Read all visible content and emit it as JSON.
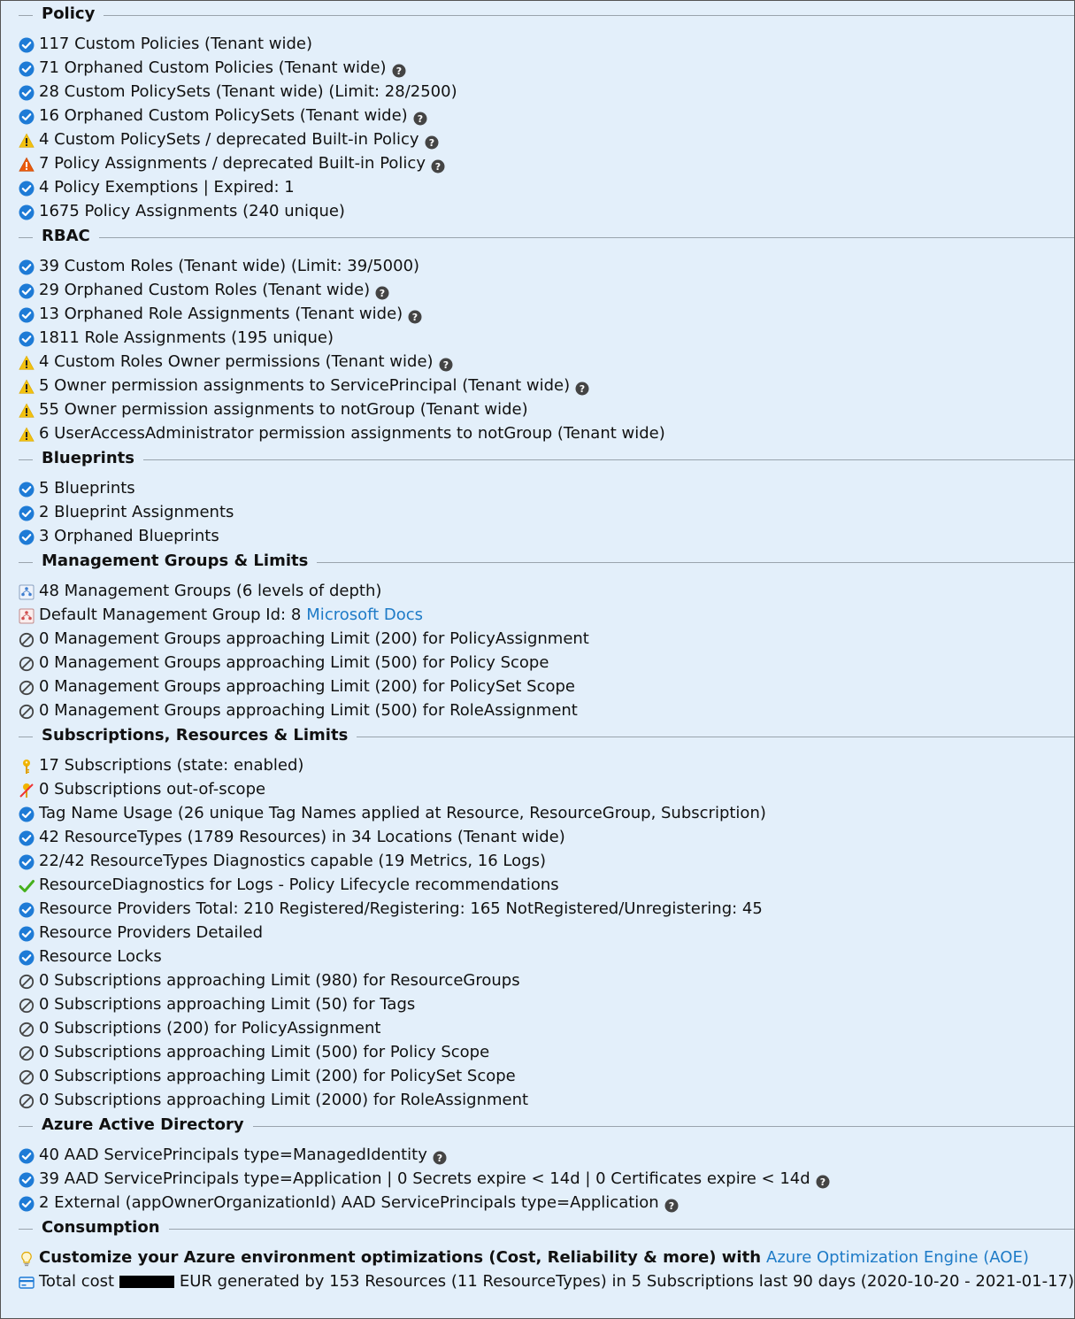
{
  "sections": [
    {
      "title": "Policy",
      "rows": [
        {
          "icon": "check-circle",
          "text": "117 Custom Policies (Tenant wide)",
          "help": false
        },
        {
          "icon": "check-circle",
          "text": "71 Orphaned Custom Policies (Tenant wide)",
          "help": true
        },
        {
          "icon": "check-circle",
          "text": "28 Custom PolicySets (Tenant wide) (Limit: 28/2500)",
          "help": false
        },
        {
          "icon": "check-circle",
          "text": "16 Orphaned Custom PolicySets (Tenant wide)",
          "help": true
        },
        {
          "icon": "warning-yellow",
          "text": "4 Custom PolicySets / deprecated Built-in Policy",
          "help": true
        },
        {
          "icon": "warning-orange",
          "text": "7 Policy Assignments / deprecated Built-in Policy",
          "help": true
        },
        {
          "icon": "check-circle",
          "text": "4 Policy Exemptions | Expired: 1",
          "help": false
        },
        {
          "icon": "check-circle",
          "text": "1675 Policy Assignments (240 unique)",
          "help": false
        }
      ]
    },
    {
      "title": "RBAC",
      "rows": [
        {
          "icon": "check-circle",
          "text": "39 Custom Roles (Tenant wide) (Limit: 39/5000)",
          "help": false
        },
        {
          "icon": "check-circle",
          "text": "29 Orphaned Custom Roles (Tenant wide)",
          "help": true
        },
        {
          "icon": "check-circle",
          "text": "13 Orphaned Role Assignments (Tenant wide)",
          "help": true
        },
        {
          "icon": "check-circle",
          "text": "1811 Role Assignments (195 unique)",
          "help": false
        },
        {
          "icon": "warning-yellow",
          "text": "4 Custom Roles Owner permissions (Tenant wide)",
          "help": true
        },
        {
          "icon": "warning-yellow",
          "text": "5 Owner permission assignments to ServicePrincipal (Tenant wide)",
          "help": true
        },
        {
          "icon": "warning-yellow",
          "text": "55 Owner permission assignments to notGroup (Tenant wide)",
          "help": false
        },
        {
          "icon": "warning-yellow",
          "text": "6 UserAccessAdministrator permission assignments to notGroup (Tenant wide)",
          "help": false
        }
      ]
    },
    {
      "title": "Blueprints",
      "rows": [
        {
          "icon": "check-circle",
          "text": "5 Blueprints",
          "help": false
        },
        {
          "icon": "check-circle",
          "text": "2 Blueprint Assignments",
          "help": false
        },
        {
          "icon": "check-circle",
          "text": "3 Orphaned Blueprints",
          "help": false
        }
      ]
    },
    {
      "title": "Management Groups & Limits",
      "rows": [
        {
          "icon": "management-group",
          "text": "48 Management Groups (6 levels of depth)",
          "help": false
        },
        {
          "icon": "management-group-default",
          "text": "Default Management Group Id: 8",
          "help": false,
          "link": "Microsoft Docs"
        },
        {
          "icon": "prohibited",
          "text": "0 Management Groups approaching Limit (200) for PolicyAssignment",
          "help": false
        },
        {
          "icon": "prohibited",
          "text": "0 Management Groups approaching Limit (500) for Policy Scope",
          "help": false
        },
        {
          "icon": "prohibited",
          "text": "0 Management Groups approaching Limit (200) for PolicySet Scope",
          "help": false
        },
        {
          "icon": "prohibited",
          "text": "0 Management Groups approaching Limit (500) for RoleAssignment",
          "help": false
        }
      ]
    },
    {
      "title": "Subscriptions, Resources & Limits",
      "rows": [
        {
          "icon": "key",
          "text": "17 Subscriptions (state: enabled)",
          "help": false
        },
        {
          "icon": "key-disabled",
          "text": "0 Subscriptions out-of-scope",
          "help": false
        },
        {
          "icon": "check-circle",
          "text": "Tag Name Usage (26 unique Tag Names applied at Resource, ResourceGroup, Subscription)",
          "help": false
        },
        {
          "icon": "check-circle",
          "text": "42 ResourceTypes (1789 Resources) in 34 Locations (Tenant wide)",
          "help": false
        },
        {
          "icon": "check-circle",
          "text": "22/42 ResourceTypes Diagnostics capable (19 Metrics, 16 Logs)",
          "help": false
        },
        {
          "icon": "checkmark-green",
          "text": "ResourceDiagnostics for Logs - Policy Lifecycle recommendations",
          "help": false
        },
        {
          "icon": "check-circle",
          "text": "Resource Providers Total: 210 Registered/Registering: 165 NotRegistered/Unregistering: 45",
          "help": false
        },
        {
          "icon": "check-circle",
          "text": "Resource Providers Detailed",
          "help": false
        },
        {
          "icon": "check-circle",
          "text": "Resource Locks",
          "help": false
        },
        {
          "icon": "prohibited",
          "text": "0 Subscriptions approaching Limit (980) for ResourceGroups",
          "help": false
        },
        {
          "icon": "prohibited",
          "text": "0 Subscriptions approaching Limit (50) for Tags",
          "help": false
        },
        {
          "icon": "prohibited",
          "text": "0 Subscriptions (200) for PolicyAssignment",
          "help": false
        },
        {
          "icon": "prohibited",
          "text": "0 Subscriptions approaching Limit (500) for Policy Scope",
          "help": false
        },
        {
          "icon": "prohibited",
          "text": "0 Subscriptions approaching Limit (200) for PolicySet Scope",
          "help": false
        },
        {
          "icon": "prohibited",
          "text": "0 Subscriptions approaching Limit (2000) for RoleAssignment",
          "help": false
        }
      ]
    },
    {
      "title": "Azure Active Directory",
      "rows": [
        {
          "icon": "check-circle",
          "text": "40 AAD ServicePrincipals type=ManagedIdentity",
          "help": true
        },
        {
          "icon": "check-circle",
          "text": "39 AAD ServicePrincipals type=Application | 0 Secrets expire < 14d | 0 Certificates expire < 14d",
          "help": true
        },
        {
          "icon": "check-circle",
          "text": "2 External (appOwnerOrganizationId) AAD ServicePrincipals type=Application",
          "help": true
        }
      ]
    },
    {
      "title": "Consumption",
      "rows": [
        {
          "icon": "lightbulb",
          "text": "Customize your Azure environment optimizations (Cost, Reliability & more) with",
          "help": false,
          "bold": true,
          "link": "Azure Optimization Engine (AOE)"
        },
        {
          "icon": "billing-card",
          "text_before": "Total cost",
          "text": "EUR generated by 153 Resources (11 ResourceTypes) in 5 Subscriptions last 90 days (2020-10-20 - 2021-01-17)",
          "help": false,
          "redacted": true
        }
      ]
    }
  ],
  "colors": {
    "background": "#e3effa",
    "check_blue": "#1e7bd6",
    "warning_yellow": "#f2c10f",
    "warning_orange": "#ea5a0c",
    "check_green": "#45b01c",
    "link": "#1e7bc7"
  }
}
